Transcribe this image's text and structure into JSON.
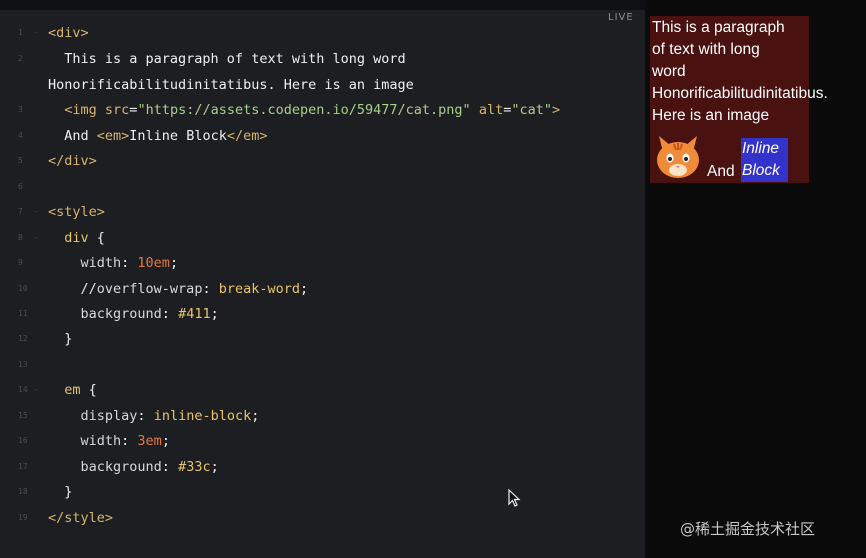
{
  "editor": {
    "live_label": "LIVE",
    "lines": [
      {
        "n": "1",
        "fold": "-",
        "segs": [
          [
            "tag",
            "<div>"
          ]
        ]
      },
      {
        "n": "2",
        "fold": "",
        "segs": [
          [
            "plain",
            "  This is a paragraph of text with long word"
          ]
        ]
      },
      {
        "n": "",
        "fold": "",
        "segs": [
          [
            "plain",
            "Honorificabilitudinitatibus. Here is an image"
          ]
        ]
      },
      {
        "n": "3",
        "fold": "",
        "segs": [
          [
            "plain",
            "  "
          ],
          [
            "tag",
            "<img "
          ],
          [
            "attr",
            "src"
          ],
          [
            "plain",
            "="
          ],
          [
            "str",
            "\"https://assets.codepen.io/59477/cat.png\""
          ],
          [
            "plain",
            " "
          ],
          [
            "attr",
            "alt"
          ],
          [
            "plain",
            "="
          ],
          [
            "str",
            "\"cat\""
          ],
          [
            "tag",
            ">"
          ]
        ]
      },
      {
        "n": "4",
        "fold": "",
        "segs": [
          [
            "plain",
            "  And "
          ],
          [
            "tag",
            "<em>"
          ],
          [
            "plain",
            "Inline Block"
          ],
          [
            "tag",
            "</em>"
          ]
        ]
      },
      {
        "n": "5",
        "fold": "",
        "segs": [
          [
            "tag",
            "</div>"
          ]
        ]
      },
      {
        "n": "6",
        "fold": "",
        "segs": []
      },
      {
        "n": "7",
        "fold": "-",
        "segs": [
          [
            "tag",
            "<style>"
          ]
        ]
      },
      {
        "n": "8",
        "fold": "-",
        "segs": [
          [
            "plain",
            "  "
          ],
          [
            "val",
            "div"
          ],
          [
            "plain",
            " {"
          ]
        ]
      },
      {
        "n": "9",
        "fold": "",
        "segs": [
          [
            "plain",
            "    "
          ],
          [
            "prop",
            "width"
          ],
          [
            "plain",
            ": "
          ],
          [
            "num",
            "10em"
          ],
          [
            "plain",
            ";"
          ]
        ]
      },
      {
        "n": "10",
        "fold": "",
        "segs": [
          [
            "plain",
            "    "
          ],
          [
            "cmt",
            "//"
          ],
          [
            "prop",
            "overflow-wrap"
          ],
          [
            "plain",
            ": "
          ],
          [
            "val",
            "break-word"
          ],
          [
            "plain",
            ";"
          ]
        ]
      },
      {
        "n": "11",
        "fold": "",
        "segs": [
          [
            "plain",
            "    "
          ],
          [
            "prop",
            "background"
          ],
          [
            "plain",
            ": "
          ],
          [
            "val",
            "#411"
          ],
          [
            "plain",
            ";"
          ]
        ]
      },
      {
        "n": "12",
        "fold": "",
        "segs": [
          [
            "plain",
            "  }"
          ]
        ]
      },
      {
        "n": "13",
        "fold": "",
        "segs": []
      },
      {
        "n": "14",
        "fold": "-",
        "segs": [
          [
            "plain",
            "  "
          ],
          [
            "val",
            "em"
          ],
          [
            "plain",
            " {"
          ]
        ]
      },
      {
        "n": "15",
        "fold": "",
        "segs": [
          [
            "plain",
            "    "
          ],
          [
            "prop",
            "display"
          ],
          [
            "plain",
            ": "
          ],
          [
            "val",
            "inline-block"
          ],
          [
            "plain",
            ";"
          ]
        ]
      },
      {
        "n": "16",
        "fold": "",
        "segs": [
          [
            "plain",
            "    "
          ],
          [
            "prop",
            "width"
          ],
          [
            "plain",
            ": "
          ],
          [
            "num",
            "3em"
          ],
          [
            "plain",
            ";"
          ]
        ]
      },
      {
        "n": "17",
        "fold": "",
        "segs": [
          [
            "plain",
            "    "
          ],
          [
            "prop",
            "background"
          ],
          [
            "plain",
            ": "
          ],
          [
            "val",
            "#33c"
          ],
          [
            "plain",
            ";"
          ]
        ]
      },
      {
        "n": "18",
        "fold": "",
        "segs": [
          [
            "plain",
            "  }"
          ]
        ]
      },
      {
        "n": "19",
        "fold": "",
        "segs": [
          [
            "tag",
            "</style>"
          ]
        ]
      }
    ]
  },
  "preview": {
    "lines": [
      "This is a paragraph",
      "of text with long",
      "word",
      "Honorificabilitudinitatibus.",
      "Here is an image"
    ],
    "and_label": "And",
    "em_lines": [
      "Inline",
      "Block"
    ],
    "cat_alt": "cat",
    "div_background": "#441111",
    "em_background": "#3333cc"
  },
  "watermark": "@稀土掘金技术社区"
}
